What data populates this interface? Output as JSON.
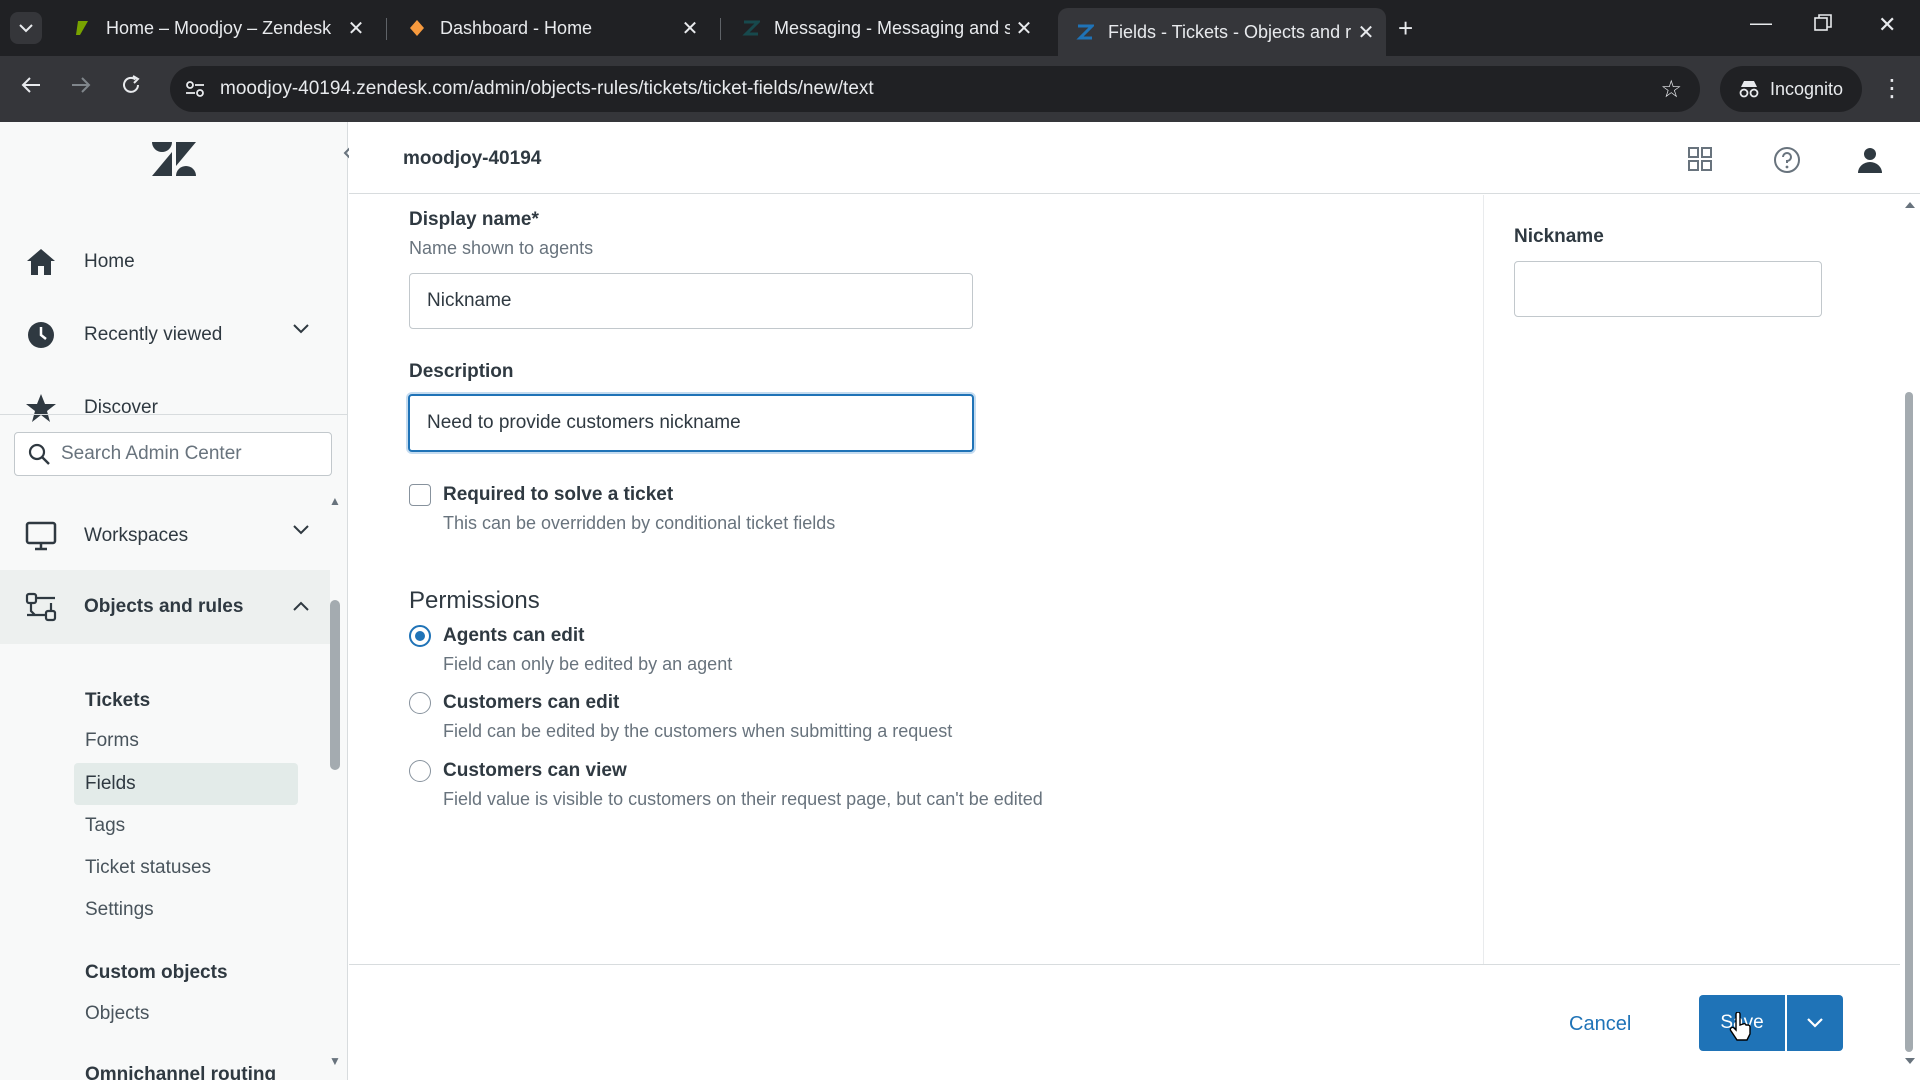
{
  "browser": {
    "tabs": [
      {
        "title": "Home – Moodjoy – Zendesk",
        "active": false
      },
      {
        "title": "Dashboard - Home",
        "active": false
      },
      {
        "title": "Messaging - Messaging and so",
        "active": false
      },
      {
        "title": "Fields - Tickets - Objects and ru",
        "active": true
      }
    ],
    "url": "moodjoy-40194.zendesk.com/admin/objects-rules/tickets/ticket-fields/new/text",
    "incognito_label": "Incognito"
  },
  "header": {
    "account": "moodjoy-40194"
  },
  "sidebar": {
    "nav": [
      {
        "label": "Home",
        "icon": "home-icon"
      },
      {
        "label": "Recently viewed",
        "icon": "clock-icon"
      },
      {
        "label": "Discover",
        "icon": "star-icon"
      }
    ],
    "search_placeholder": "Search Admin Center",
    "sections": [
      {
        "label": "Workspaces",
        "icon": "monitor-icon"
      },
      {
        "label": "Objects and rules",
        "icon": "objects-rules-icon"
      }
    ],
    "tickets_heading": "Tickets",
    "tickets_items": [
      "Forms",
      "Fields",
      "Tags",
      "Ticket statuses",
      "Settings"
    ],
    "selected_item": "Fields",
    "custom_objects_heading": "Custom objects",
    "custom_objects_items": [
      "Objects"
    ],
    "omnichannel_heading": "Omnichannel routing"
  },
  "form": {
    "display_name_label": "Display name*",
    "display_name_hint": "Name shown to agents",
    "display_name_value": "Nickname",
    "description_label": "Description",
    "description_value": "Need to provide customers nickname",
    "required_label": "Required to solve a ticket",
    "required_hint": "This can be overridden by conditional ticket fields",
    "required_checked": false,
    "permissions_title": "Permissions",
    "permissions": [
      {
        "label": "Agents can edit",
        "hint": "Field can only be edited by an agent",
        "selected": true
      },
      {
        "label": "Customers can edit",
        "hint": "Field can be edited by the customers when submitting a request",
        "selected": false
      },
      {
        "label": "Customers can view",
        "hint": "Field value is visible to customers on their request page, but can't be edited",
        "selected": false
      }
    ]
  },
  "preview": {
    "label": "Nickname",
    "value": ""
  },
  "footer": {
    "cancel_label": "Cancel",
    "save_label": "Save"
  },
  "colors": {
    "accent": "#1f73b7",
    "sidebar_bg": "#f8f9f9",
    "chrome_dark": "#202124"
  }
}
